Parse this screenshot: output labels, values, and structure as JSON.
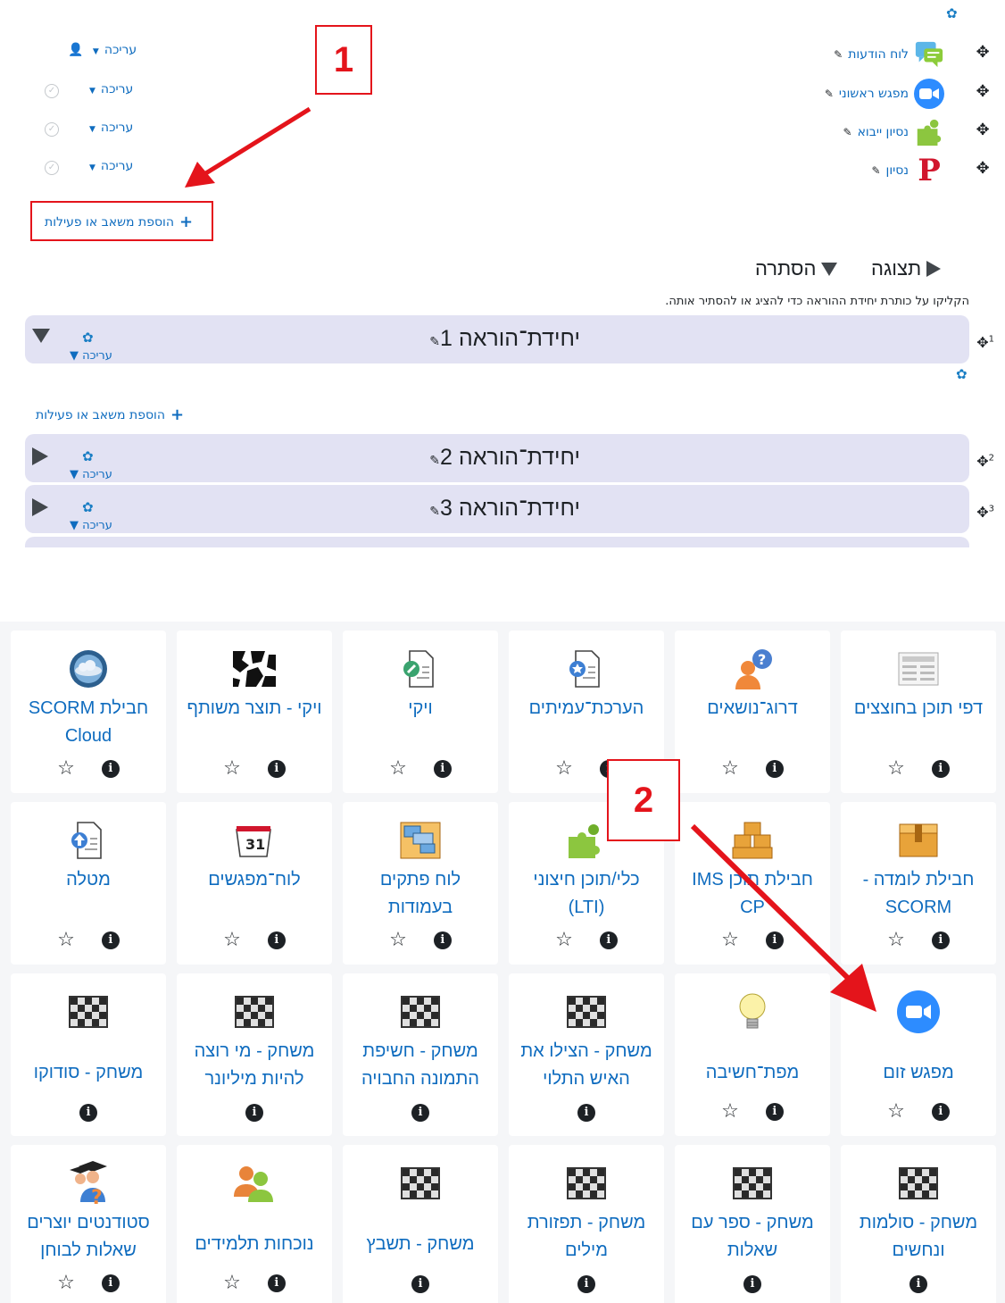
{
  "colors": {
    "link": "#0f6cbf",
    "annotation": "#e4141b",
    "section_bg": "#e2e2f3",
    "zoom": "#2d8cff"
  },
  "top": {
    "activities": [
      {
        "name": "לוח הודעות",
        "icon": "forum-icon"
      },
      {
        "name": "מפגש ראשוני",
        "icon": "zoom-icon"
      },
      {
        "name": "נסיון ייבוא",
        "icon": "puzzle-icon"
      },
      {
        "name": "נסיון",
        "icon": "p-icon"
      }
    ],
    "edit_label": "עריכה",
    "add_activity_label": "הוספת משאב או פעילות",
    "annotation_1": "1",
    "annotation_2": "2",
    "show_label": "תצוגה",
    "hide_label": "הסתרה",
    "instruction": "הקליקו על כותרת יחידת ההוראה כדי להציג או להסתיר אותה."
  },
  "sections": [
    {
      "title": "יחידת־הוראה 1",
      "num": "1",
      "edit": "עריכה"
    },
    {
      "title": "יחידת־הוראה 2",
      "num": "2",
      "edit": "עריכה"
    },
    {
      "title": "יחידת־הוראה 3",
      "num": "3",
      "edit": "עריכה"
    }
  ],
  "chooser": {
    "rows": [
      [
        "דפי תוכן בחוצצים",
        "דרוג־נושאים",
        "הערכת־עמיתים",
        "ויקי",
        "ויקי - תוצר משותף",
        "חבילת SCORM Cloud"
      ],
      [
        "חבילת לומדה - SCORM",
        "חבילת תוכן IMS CP",
        "כלי/תוכן חיצוני (LTI)",
        "לוח פתקים בעמודות",
        "לוח־מפגשים",
        "מטלה"
      ],
      [
        "מפגש זום",
        "מפת־חשיבה",
        "משחק - הצילו את האיש התלוי",
        "משחק - חשיפת התמונה החבויה",
        "משחק - מי רוצה להיות מיליונר",
        "משחק - סודוקו"
      ],
      [
        "משחק - סולמות ונחשים",
        "משחק - ספר עם שאלות",
        "משחק - תפזורת מילים",
        "משחק - תשבץ",
        "נוכחות תלמידים",
        "סטודנטים יוצרים שאלות לבוחן"
      ]
    ]
  }
}
